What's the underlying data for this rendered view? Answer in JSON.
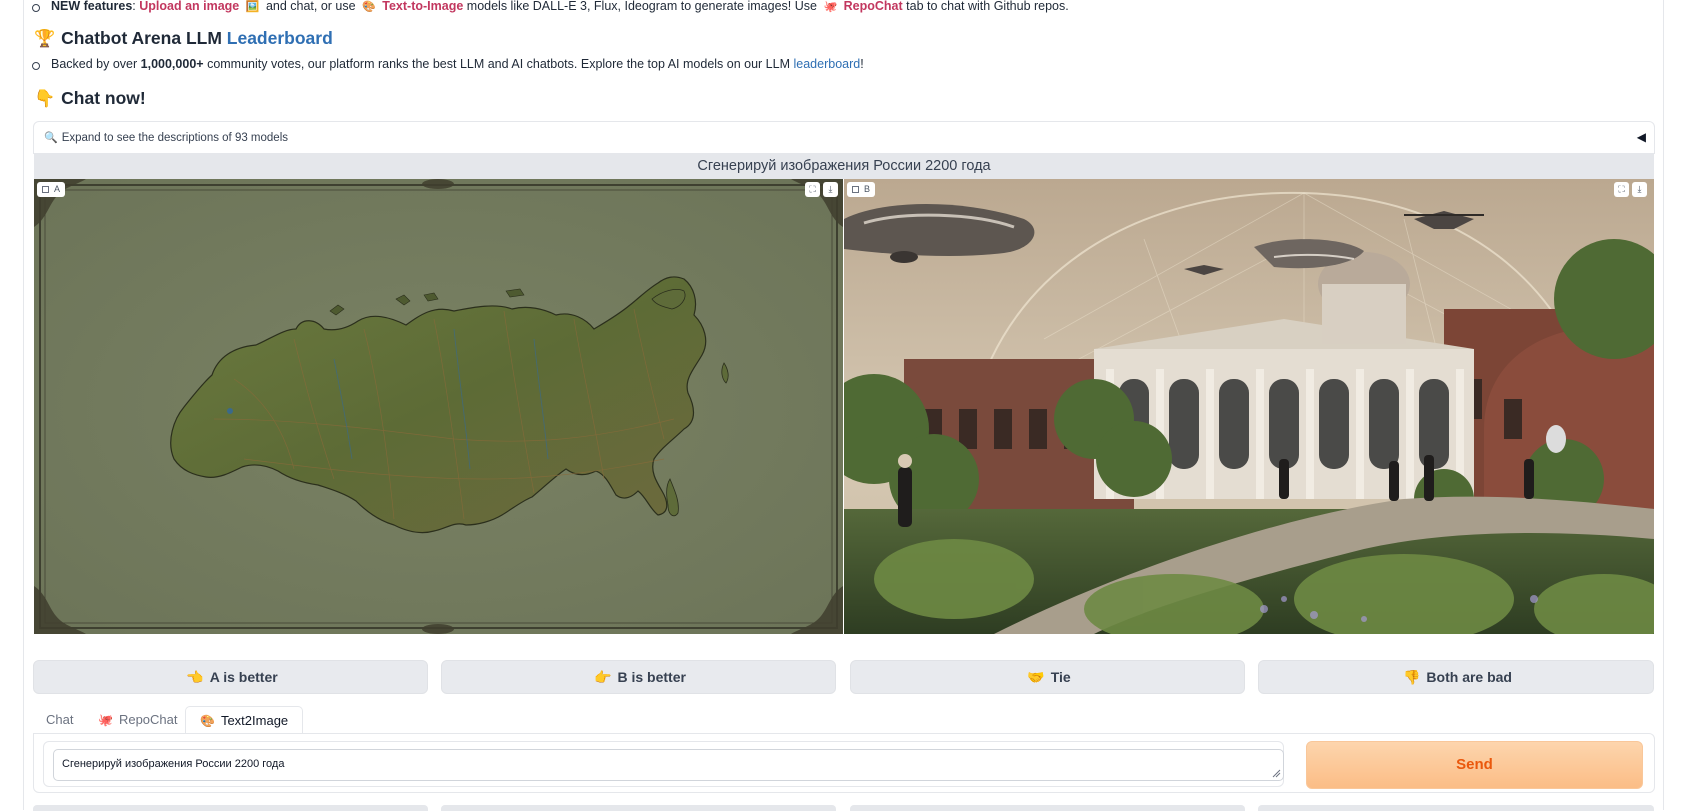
{
  "features_line": {
    "lead": "NEW features",
    "sep1": ": ",
    "upload": "Upload an image",
    "upload_emoji": "🖼️",
    "mid1": "and chat, or use",
    "t2i_emoji": "🎨",
    "t2i": "Text-to-Image",
    "mid2": "models like DALL-E 3, Flux, Ideogram to generate images! Use",
    "repo_emoji": "🐙",
    "repochat": "RepoChat",
    "tail": "tab to chat with Github repos."
  },
  "leaderboard_heading": {
    "emoji": "🏆",
    "prefix": "Chatbot Arena LLM",
    "link": "Leaderboard"
  },
  "votes_line": {
    "pre": "Backed by over",
    "count": "1,000,000+",
    "mid": "community votes, our platform ranks the best LLM and AI chatbots. Explore the top AI models on our LLM",
    "link": "leaderboard",
    "end": "!"
  },
  "chat_heading": {
    "emoji": "👇",
    "text": "Chat now!"
  },
  "accordion": {
    "emoji": "🔍",
    "label": "Expand to see the descriptions of 93 models",
    "toggle": "◀"
  },
  "prompt_display": "Сгенерируй изображения России 2200 года",
  "image_a": {
    "label": "A",
    "icon": "image-icon"
  },
  "image_b": {
    "label": "B",
    "icon": "image-icon"
  },
  "image_tools": {
    "fullscreen": "⛶",
    "download": "⤓"
  },
  "vote_buttons": [
    {
      "emoji": "👈",
      "label": "A is better"
    },
    {
      "emoji": "👉",
      "label": "B is better"
    },
    {
      "emoji": "🤝",
      "label": "Tie"
    },
    {
      "emoji": "👎",
      "label": "Both are bad"
    }
  ],
  "tabs": [
    {
      "label": "Chat",
      "emoji": "",
      "active": false
    },
    {
      "label": "RepoChat",
      "emoji": "🐙",
      "active": false
    },
    {
      "label": "Text2Image",
      "emoji": "🎨",
      "active": true
    }
  ],
  "input": {
    "value": "Сгенерируй изображения России 2200 года"
  },
  "send_label": "Send",
  "colors": {
    "accent_orange": "#ea580c",
    "link_blue": "#2f6fb3",
    "feature_pink": "#c2375f"
  }
}
